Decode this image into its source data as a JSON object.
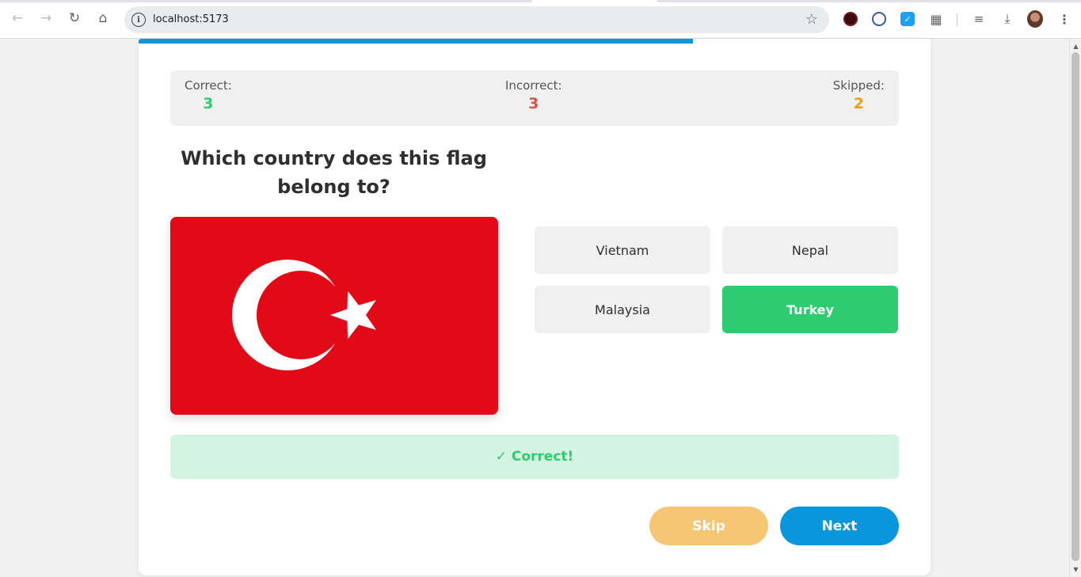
{
  "browser": {
    "url": "localhost:5173",
    "icons": {
      "back": "arrow-left-icon",
      "forward": "arrow-right-icon",
      "reload": "reload-icon",
      "home": "home-icon",
      "info": "info-icon",
      "bookmark": "star-icon",
      "extensions": "puzzle-icon",
      "media": "media-control-icon",
      "downloads": "download-icon",
      "menu": "kebab-menu-icon"
    }
  },
  "quiz": {
    "progress": 0.7,
    "stats": {
      "correct_label": "Correct:",
      "correct_value": "3",
      "incorrect_label": "Incorrect:",
      "incorrect_value": "3",
      "skipped_label": "Skipped:",
      "skipped_value": "2"
    },
    "question": "Which country does this flag belong to?",
    "flag": "turkey-flag",
    "options": [
      {
        "label": "Vietnam",
        "state": "default"
      },
      {
        "label": "Nepal",
        "state": "default"
      },
      {
        "label": "Malaysia",
        "state": "default"
      },
      {
        "label": "Turkey",
        "state": "correct"
      }
    ],
    "feedback": "✓ Correct!",
    "skip_label": "Skip",
    "next_label": "Next"
  },
  "colors": {
    "accent": "#0996dd",
    "correct": "#2ecc71",
    "incorrect": "#e74c3c",
    "skipped": "#f39c12",
    "skip_button": "#f7c674",
    "flag_red": "#e30a17"
  }
}
